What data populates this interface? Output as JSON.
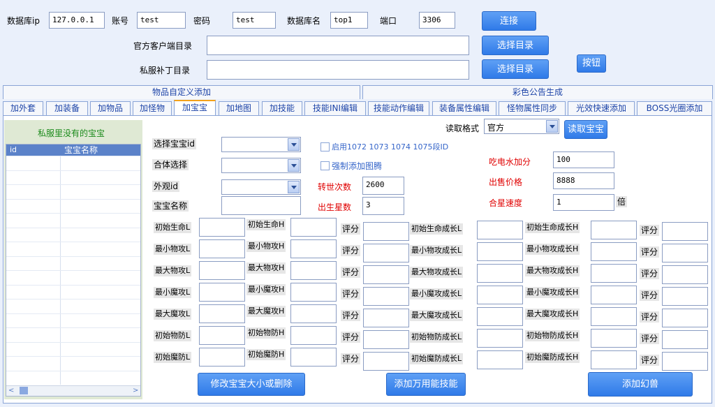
{
  "top": {
    "db_ip_label": "数据库ip",
    "db_ip_value": "127.0.0.1",
    "account_label": "账号",
    "account_value": "test",
    "password_label": "密码",
    "password_value": "test",
    "dbname_label": "数据库名",
    "dbname_value": "top1",
    "port_label": "端口",
    "port_value": "3306",
    "connect_button": "连接",
    "client_dir_label": "官方客户端目录",
    "client_dir_value": "",
    "patch_dir_label": "私服补丁目录",
    "patch_dir_value": "",
    "select_dir_button": "选择目录",
    "select_dir_button2": "选择目录",
    "generic_button": "按钮"
  },
  "tabs_row1": [
    "物品自定义添加",
    "彩色公告生成"
  ],
  "tabs_row2": [
    "加外套",
    "加装备",
    "加物品",
    "加怪物",
    "加宝宝",
    "加地图",
    "加技能",
    "技能INI编辑",
    "技能动作编辑",
    "装备属性编辑",
    "怪物属性同步",
    "光效快速添加",
    "BOSS光圈添加"
  ],
  "left_panel": {
    "title": "私服里没有的宝宝",
    "col_id": "id",
    "col_name": "宝宝名称",
    "rows": 16
  },
  "pet_form": {
    "read_format_label": "读取格式",
    "read_format_value": "官方",
    "read_pet_button": "读取宝宝",
    "select_pet_id_label": "选择宝宝id",
    "combine_label": "合体选择",
    "appearance_label": "外观id",
    "pet_name_label": "宝宝名称",
    "pet_name_value": "",
    "enable_segment_label": "启用1072 1073 1074 1075段ID",
    "force_totem_label": "强制添加图腾",
    "rebirth_label": "转世次数",
    "rebirth_value": "2600",
    "birth_star_label": "出生星数",
    "birth_star_value": "3",
    "electric_bonus_label": "吃电水加分",
    "electric_bonus_value": "100",
    "sale_price_label": "出售价格",
    "sale_price_value": "8888",
    "star_speed_label": "合星速度",
    "star_speed_value": "1",
    "times_label": "倍"
  },
  "stats_left": [
    {
      "l": "初始生命L",
      "h": "初始生命H"
    },
    {
      "l": "最小物攻L",
      "h": "最小物攻H"
    },
    {
      "l": "最大物攻L",
      "h": "最大物攻H"
    },
    {
      "l": "最小魔攻L",
      "h": "最小魔攻H"
    },
    {
      "l": "最大魔攻L",
      "h": "最大魔攻H"
    },
    {
      "l": "初始物防L",
      "h": "初始物防H"
    },
    {
      "l": "初始魔防L",
      "h": "初始魔防H"
    }
  ],
  "stats_right": [
    {
      "l": "初始生命成长L",
      "h": "初始生命成长H"
    },
    {
      "l": "最小物攻成长L",
      "h": "最小物攻成长H"
    },
    {
      "l": "最大物攻成长L",
      "h": "最大物攻成长H"
    },
    {
      "l": "最小魔攻成长L",
      "h": "最小魔攻成长H"
    },
    {
      "l": "最大魔攻成长L",
      "h": "最大魔攻成长H"
    },
    {
      "l": "初始物防成长L",
      "h": "初始物防成长H"
    },
    {
      "l": "初始魔防成长L",
      "h": "初始魔防成长H"
    }
  ],
  "score_label": "评分",
  "bottom_buttons": {
    "modify": "修改宝宝大小或删除",
    "add_skill": "添加万用能技能",
    "add_phantom": "添加幻兽"
  }
}
